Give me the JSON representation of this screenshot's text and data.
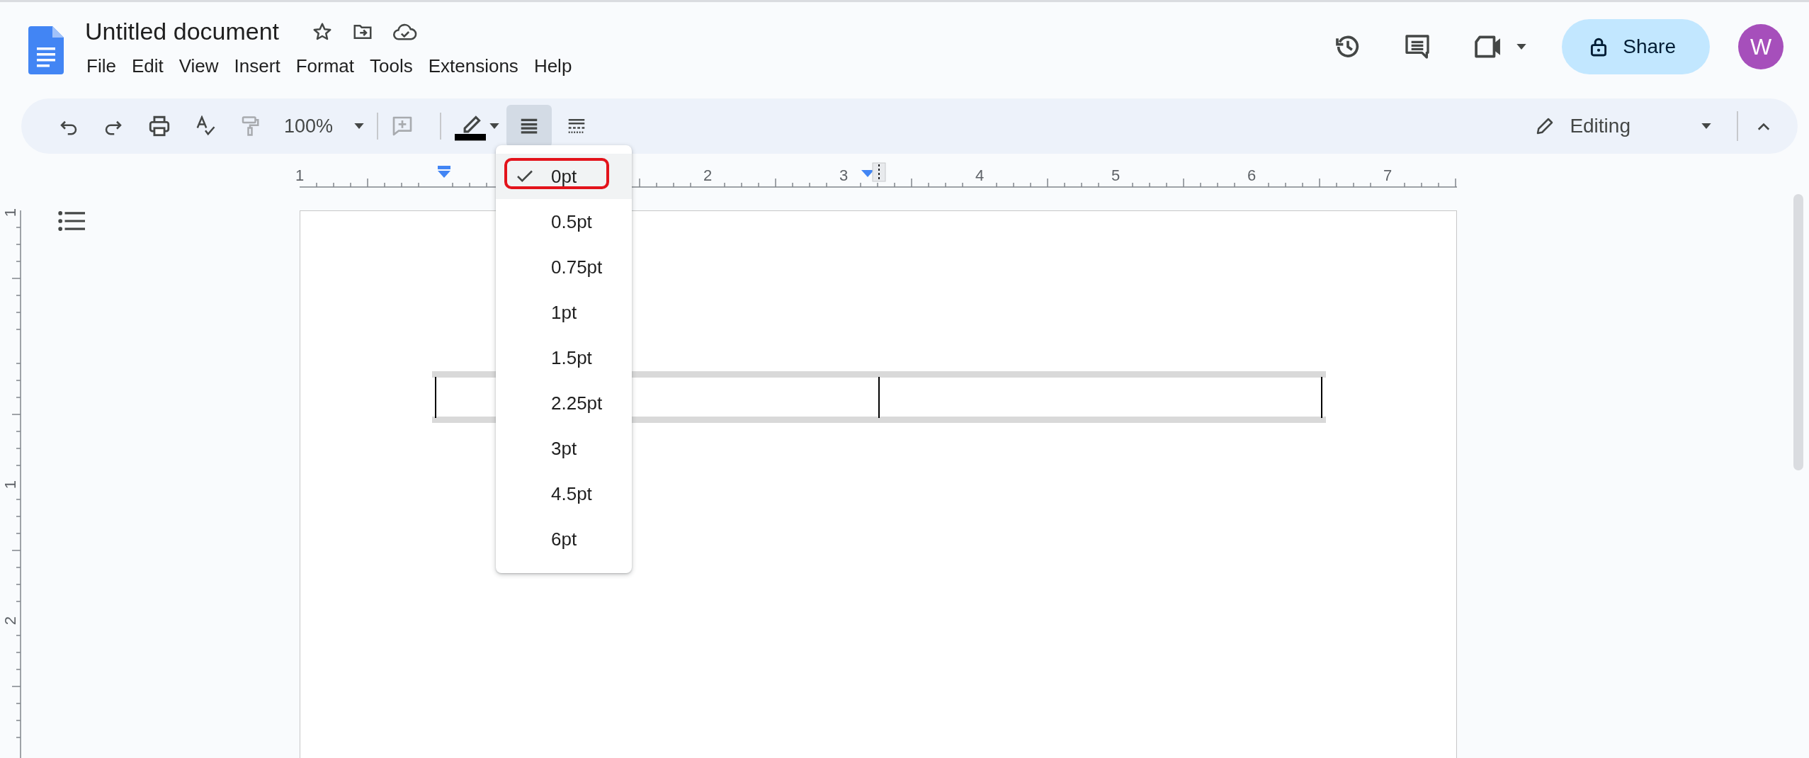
{
  "document": {
    "title": "Untitled document"
  },
  "menu": [
    "File",
    "Edit",
    "View",
    "Insert",
    "Format",
    "Tools",
    "Extensions",
    "Help"
  ],
  "header": {
    "share_button": "Share",
    "avatar": "W"
  },
  "toolbar": {
    "zoom": "100%",
    "mode": "Editing"
  },
  "ruler": {
    "labels": [
      "1",
      "2",
      "3",
      "4",
      "5",
      "6",
      "7"
    ]
  },
  "vertical_ruler": {
    "labels": [
      "1",
      "1",
      "2"
    ]
  },
  "border_width_menu": {
    "items": [
      {
        "label": "0pt",
        "selected": true,
        "outlined": true
      },
      {
        "label": "0.5pt",
        "selected": false,
        "outlined": false
      },
      {
        "label": "0.75pt",
        "selected": false,
        "outlined": false
      },
      {
        "label": "1pt",
        "selected": false,
        "outlined": false
      },
      {
        "label": "1.5pt",
        "selected": false,
        "outlined": false
      },
      {
        "label": "2.25pt",
        "selected": false,
        "outlined": false
      },
      {
        "label": "3pt",
        "selected": false,
        "outlined": false
      },
      {
        "label": "4.5pt",
        "selected": false,
        "outlined": false
      },
      {
        "label": "6pt",
        "selected": false,
        "outlined": false
      }
    ]
  }
}
